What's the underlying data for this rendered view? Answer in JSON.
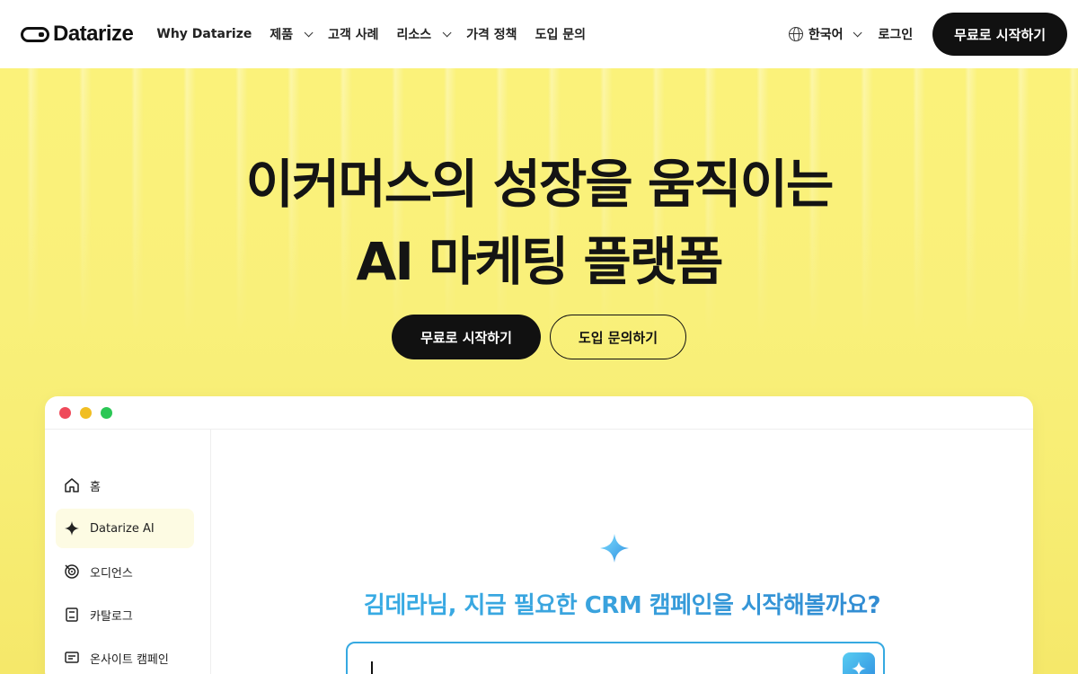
{
  "nav": {
    "logo": "Datarize",
    "links": [
      {
        "label": "Why Datarize",
        "dropdown": false
      },
      {
        "label": "제품",
        "dropdown": true
      },
      {
        "label": "고객 사례",
        "dropdown": false
      },
      {
        "label": "리소스",
        "dropdown": true
      },
      {
        "label": "가격 정책",
        "dropdown": false
      },
      {
        "label": "도입 문의",
        "dropdown": false
      }
    ],
    "language": "한국어",
    "login": "로그인",
    "cta": "무료로 시작하기"
  },
  "hero": {
    "title_line1": "이커머스의 성장을 움직이는",
    "title_line2": "AI 마케팅 플랫폼",
    "primary_button": "무료로 시작하기",
    "secondary_button": "도입 문의하기"
  },
  "app": {
    "window_dots": [
      "#ef4a5a",
      "#f1be22",
      "#2bc755"
    ],
    "sidebar": [
      {
        "label": "홈",
        "icon": "home-icon",
        "active": false
      },
      {
        "label": "Datarize AI",
        "icon": "sparkle-icon",
        "active": true
      },
      {
        "label": "오디언스",
        "icon": "target-icon",
        "active": false
      },
      {
        "label": "카탈로그",
        "icon": "catalog-icon",
        "active": false
      },
      {
        "label": "온사이트 캠페인",
        "icon": "onsite-campaign-icon",
        "active": false
      }
    ],
    "prompt": "김데라님, 지금 필요한 CRM 캠페인을 시작해볼까요?",
    "input_value": ""
  },
  "colors": {
    "hero_yellow": "#f9f07a",
    "accent_blue": "#36a9e1",
    "dark": "#111111"
  }
}
